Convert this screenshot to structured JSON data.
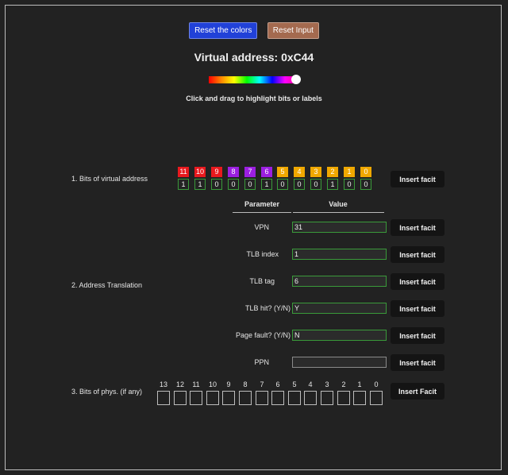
{
  "toolbar": {
    "reset_colors_label": "Reset the colors",
    "reset_input_label": "Reset Input"
  },
  "title": "Virtual address: 0xC44",
  "hint": "Click and drag to highlight bits or labels",
  "slider": {
    "value": 0.97
  },
  "sections": {
    "virtual_bits_label": "1. Bits of virtual address",
    "translation_label": "2. Address Translation",
    "phys_bits_label": "3. Bits of phys. (if any)"
  },
  "virtual_bits": [
    {
      "index": "11",
      "value": "1",
      "color": "#e8191e"
    },
    {
      "index": "10",
      "value": "1",
      "color": "#e8191e"
    },
    {
      "index": "9",
      "value": "0",
      "color": "#e8191e"
    },
    {
      "index": "8",
      "value": "0",
      "color": "#9b1fe0"
    },
    {
      "index": "7",
      "value": "0",
      "color": "#9b1fe0"
    },
    {
      "index": "6",
      "value": "1",
      "color": "#9b1fe0"
    },
    {
      "index": "5",
      "value": "0",
      "color": "#f0a800"
    },
    {
      "index": "4",
      "value": "0",
      "color": "#f0a800"
    },
    {
      "index": "3",
      "value": "0",
      "color": "#f0a800"
    },
    {
      "index": "2",
      "value": "1",
      "color": "#f0a800"
    },
    {
      "index": "1",
      "value": "0",
      "color": "#f0a800"
    },
    {
      "index": "0",
      "value": "0",
      "color": "#f0a800"
    }
  ],
  "table": {
    "param_header": "Parameter",
    "value_header": "Value",
    "rows": [
      {
        "label": "VPN",
        "value": ""
      },
      {
        "label": "TLB index",
        "value": "1"
      },
      {
        "label": "TLB tag",
        "value": "6"
      },
      {
        "label": "TLB hit? (Y/N)",
        "value": "Y"
      },
      {
        "label": "Page fault? (Y/N)",
        "value": "N"
      },
      {
        "label": "PPN",
        "value": ""
      }
    ],
    "vpn_value": "31"
  },
  "insert_label": "Insert facit",
  "insert_label_phys": "Insert Facit",
  "phys_bits": [
    "13",
    "12",
    "11",
    "10",
    "9",
    "8",
    "7",
    "6",
    "5",
    "4",
    "3",
    "2",
    "1",
    "0"
  ]
}
